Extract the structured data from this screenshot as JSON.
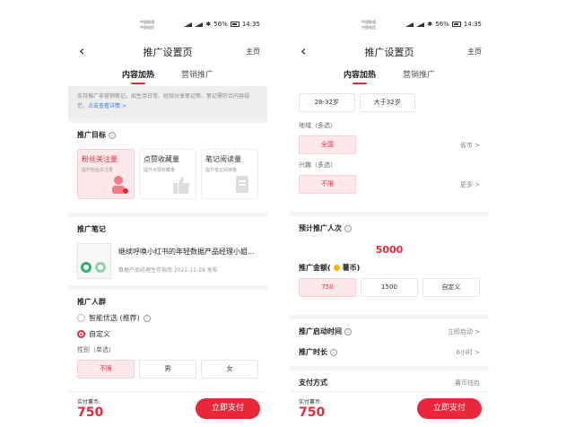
{
  "status": {
    "carrier1": "中国联通",
    "carrier2": "中国电信",
    "battery": "56%",
    "time": "14:35"
  },
  "nav": {
    "back": "‹",
    "title": "推广设置页",
    "home": "主页"
  },
  "tabs": [
    {
      "label": "内容加热",
      "active": true
    },
    {
      "label": "营销推广",
      "active": false
    }
  ],
  "left": {
    "notice": "支持推广非营销笔记，如生活日常、经验分享笔记等，笔记需符合内容规范，",
    "notice_link": "点击查看详情 >",
    "goal_title": "推广目标",
    "goals": [
      {
        "title": "粉丝关注量",
        "sub": "提升粉丝关注量",
        "active": true
      },
      {
        "title": "点赞收藏量",
        "sub": "提升点赞收藏量",
        "active": false
      },
      {
        "title": "笔记阅读量",
        "sub": "提升笔记阅读量",
        "active": false
      }
    ],
    "note_title": "推广笔记",
    "note_name": "继续呼唤小红书的年轻数据产品经理小姐...",
    "note_meta": "数据产品经理生存指南   2022-11-28 发布",
    "crowd_title": "推广人群",
    "crowd_options": [
      {
        "label": "智能优选 (推荐)",
        "checked": false
      },
      {
        "label": "自定义",
        "checked": true
      }
    ],
    "gender_label": "性别（单选）",
    "gender_options": [
      {
        "label": "不限",
        "active": true
      },
      {
        "label": "男",
        "active": false
      },
      {
        "label": "女",
        "active": false
      }
    ]
  },
  "right": {
    "age_options": [
      {
        "label": "28-32岁"
      },
      {
        "label": "大于32岁"
      }
    ],
    "region_label": "地域（多选）",
    "region_option": "全国",
    "region_link": "省市 >",
    "interest_label": "兴趣（多选）",
    "interest_option": "不限",
    "interest_link": "更多 >",
    "estimate_label": "预计推广人次",
    "estimate_value": "5000",
    "amount_label": "推广金额(",
    "amount_unit": "薯币)",
    "amount_options": [
      {
        "label": "750",
        "active": true
      },
      {
        "label": "1500",
        "active": false
      },
      {
        "label": "自定义",
        "active": false
      }
    ],
    "start_label": "推广启动时间",
    "start_value": "立即启动 >",
    "duration_label": "推广时长",
    "duration_value": "6小时 >",
    "pay_method_label": "支付方式",
    "pay_method_value": "薯币钱包"
  },
  "pay": {
    "label": "实付薯币:",
    "amount": "750",
    "button": "立即支付"
  },
  "colors": {
    "accent": "#e8283a",
    "accent_light": "#fde8ea",
    "link": "#3b82e0"
  }
}
